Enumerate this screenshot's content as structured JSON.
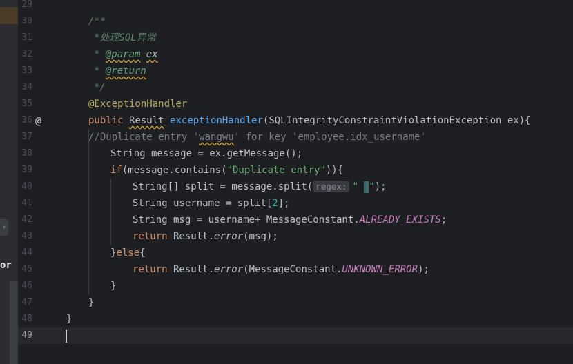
{
  "line_numbers": [
    "29",
    "30",
    "31",
    "32",
    "33",
    "34",
    "35",
    "36",
    "37",
    "38",
    "39",
    "40",
    "41",
    "42",
    "43",
    "44",
    "45",
    "46",
    "47",
    "48",
    "49"
  ],
  "current_line": "49",
  "left_panel": {
    "label_fragment": "or"
  },
  "code": {
    "l30": "/**",
    "l31": "*处理SQL异常",
    "l32_star": "* ",
    "l32_tag": "@param",
    "l32_sp": " ",
    "l32_name": "ex",
    "l33_star": "* ",
    "l33_tag": "@return",
    "l34": "*/",
    "l35": "@ExceptionHandler",
    "l36_kw": "public",
    "l36_sp1": " ",
    "l36_type": "Result",
    "l36_sp2": " ",
    "l36_fn": "exceptionHandler",
    "l36_rest": "(SQLIntegrityConstraintViolationException ex){",
    "l37_a": "//Duplicate entry '",
    "l37_b": "wangwu",
    "l37_c": "' for key 'employee.idx_username'",
    "l38": "String message = ex.getMessage();",
    "l39_kw": "if",
    "l39_a": "(message.contains(",
    "l39_str": "\"Duplicate entry\"",
    "l39_b": ")){",
    "l40_a": "String[] split = message.split(",
    "l40_hint": "regex:",
    "l40_str": "\" ",
    "l40_str2": "\"",
    "l40_b": ");",
    "l41_a": "String username = split[",
    "l41_num": "2",
    "l41_b": "];",
    "l42_a": "String msg = username+ MessageConstant.",
    "l42_const": "ALREADY_EXISTS",
    "l42_b": ";",
    "l43_kw": "return",
    "l43_a": " Result.",
    "l43_fn": "error",
    "l43_b": "(msg);",
    "l44_a": "}",
    "l44_kw": "else",
    "l44_b": "{",
    "l45_kw": "return",
    "l45_a": " Result.",
    "l45_fn": "error",
    "l45_b": "(MessageConstant.",
    "l45_const": "UNKNOWN_ERROR",
    "l45_c": ");",
    "l46": "}",
    "l47": "}",
    "l48": "}"
  }
}
